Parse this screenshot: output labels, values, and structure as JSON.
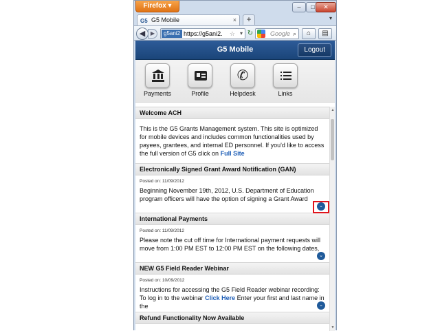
{
  "browser": {
    "menu_button": "Firefox",
    "tab_title": "G5 Mobile",
    "tab_favicon": "G5",
    "new_tab": "+",
    "identity": "g5ani2",
    "url": "https://g5ani2.",
    "search_placeholder": "Google"
  },
  "app": {
    "title": "G5 Mobile",
    "logout_label": "Logout",
    "header_color": "#1f4b82"
  },
  "nav": {
    "payments": "Payments",
    "profile": "Profile",
    "helpdesk": "Helpdesk",
    "links": "Links"
  },
  "welcome": {
    "heading": "Welcome ACH",
    "body": "This is the G5 Grants Management system. This site is optimized for mobile devices and includes common functionalities used by payees, grantees, and internal ED personnel. If you'd like to access the full version of G5 click on",
    "link": "Full Site"
  },
  "items": [
    {
      "heading": "Electronically Signed Grant Award Notification (GAN)",
      "posted": "Posted on: 11/09/2012",
      "body": "Beginning November 19th, 2012, U.S. Department of Education program officers will have the option of signing a Grant Award",
      "link": ""
    },
    {
      "heading": "International Payments",
      "posted": "Posted on: 11/09/2012",
      "body": "Please note the cut off time for International payment requests will move from 1:00 PM EST to 12:00 PM EST on the following dates,",
      "link": ""
    },
    {
      "heading": "NEW G5 Field Reader Webinar",
      "posted": "Posted on: 10/09/2012",
      "body": "Instructions for accessing the G5 Field Reader webinar recording: To log in to the webinar",
      "link": "Click Here",
      "body_after": "Enter your first and last name in the"
    },
    {
      "heading": "Refund Functionality Now Available"
    }
  ]
}
